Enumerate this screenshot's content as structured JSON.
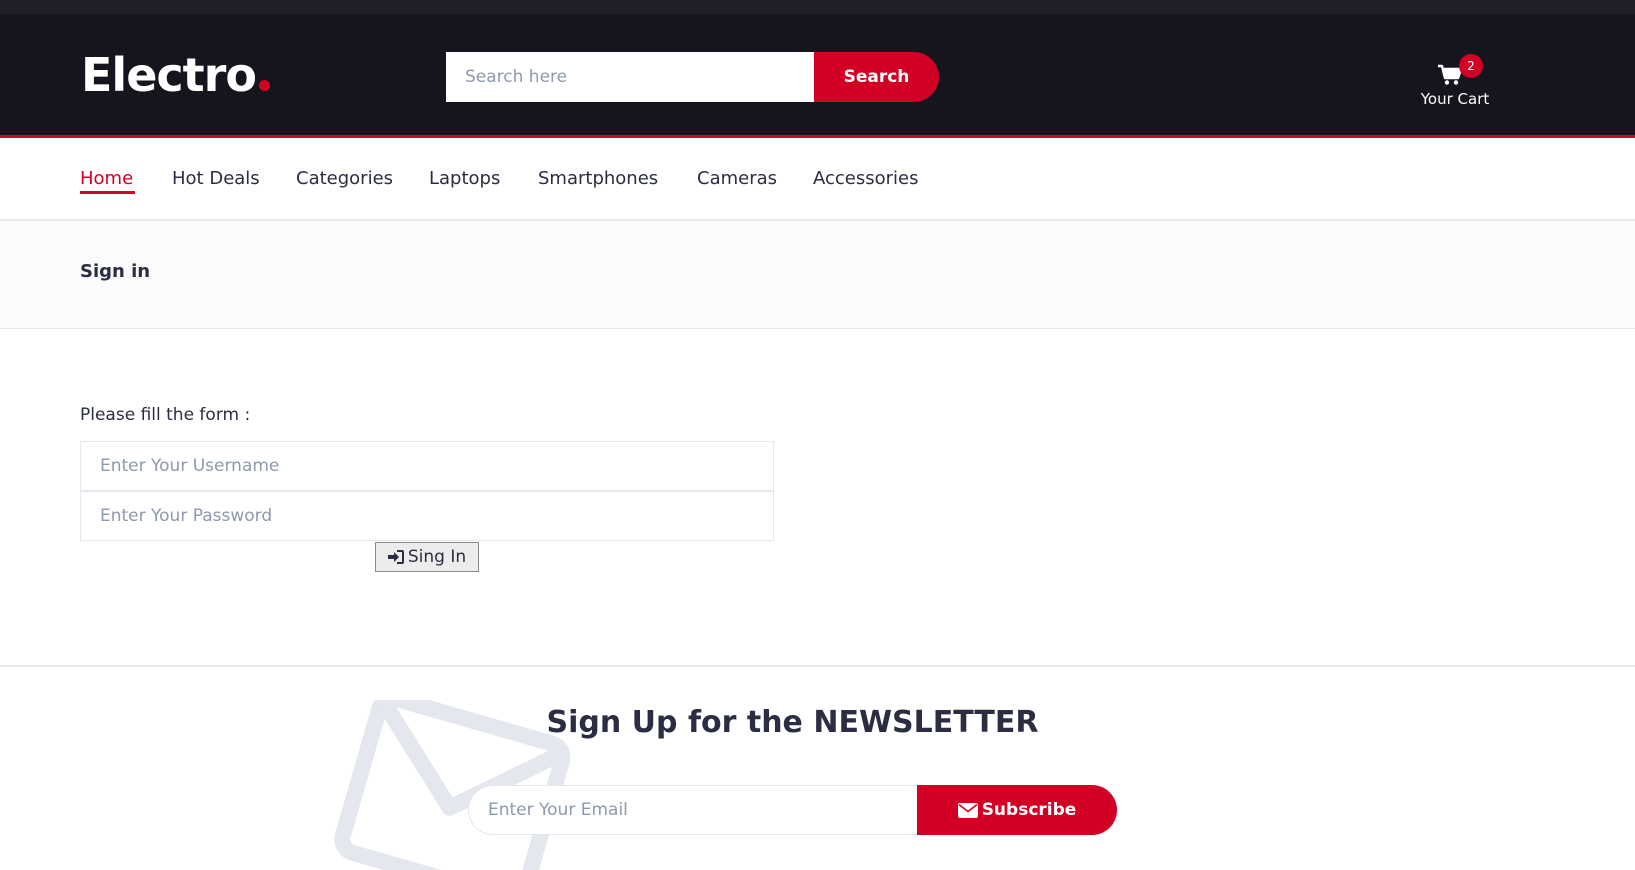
{
  "brand": {
    "name": "Electro",
    "dot": ".",
    "accent_color": "#d10024"
  },
  "search": {
    "placeholder": "Search here",
    "button_label": "Search"
  },
  "cart": {
    "count": "2",
    "label": "Your Cart",
    "icon": "shopping-cart-icon"
  },
  "nav": {
    "items": [
      {
        "label": "Home",
        "active": true
      },
      {
        "label": "Hot Deals"
      },
      {
        "label": "Categories"
      },
      {
        "label": "Laptops"
      },
      {
        "label": "Smartphones"
      },
      {
        "label": "Cameras"
      },
      {
        "label": "Accessories"
      }
    ]
  },
  "breadcrumb": {
    "title": "Sign in"
  },
  "form": {
    "intro": "Please fill the form :",
    "username_placeholder": "Enter Your Username",
    "password_placeholder": "Enter Your Password",
    "submit_label": "Sing In",
    "submit_icon": "sign-in-icon"
  },
  "newsletter": {
    "title_prefix": "Sign Up for the ",
    "title_bold": "NEWSLETTER",
    "email_placeholder": "Enter Your Email",
    "button_label": "Subscribe",
    "button_icon": "envelope-icon"
  },
  "colors": {
    "header_bg": "#15161d",
    "accent": "#d10024",
    "text": "#2b2d42"
  }
}
